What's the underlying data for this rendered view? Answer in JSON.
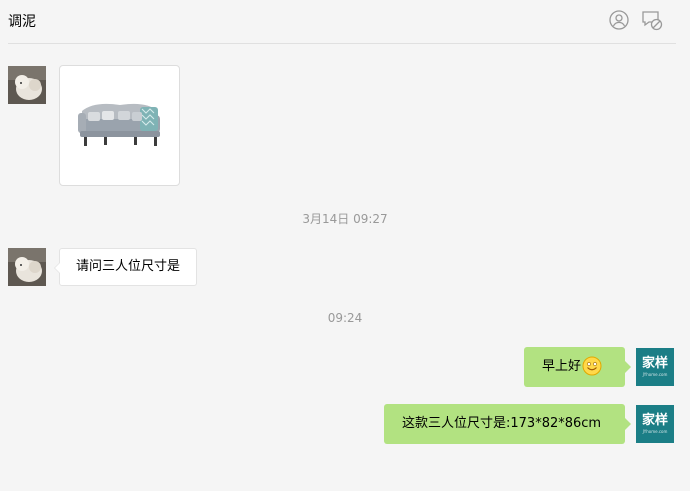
{
  "header": {
    "title": "调泥"
  },
  "messages": {
    "image_alt": "sofa-image",
    "time_1": "3月14日 09:27",
    "question": "请问三人位尺寸是",
    "time_2": "09:24",
    "greeting": "早上好",
    "answer": "这款三人位尺寸是:173*82*86cm"
  },
  "avatar_right": {
    "brand": "家样",
    "brand_sub": "JYhome.com"
  },
  "colors": {
    "bubble_sent": "#b2e281",
    "bubble_received": "#ffffff",
    "brand_avatar": "#1b7e86",
    "background": "#f5f5f5"
  },
  "icons": [
    "add-contact-icon",
    "block-icon",
    "smile-emoji-icon"
  ]
}
